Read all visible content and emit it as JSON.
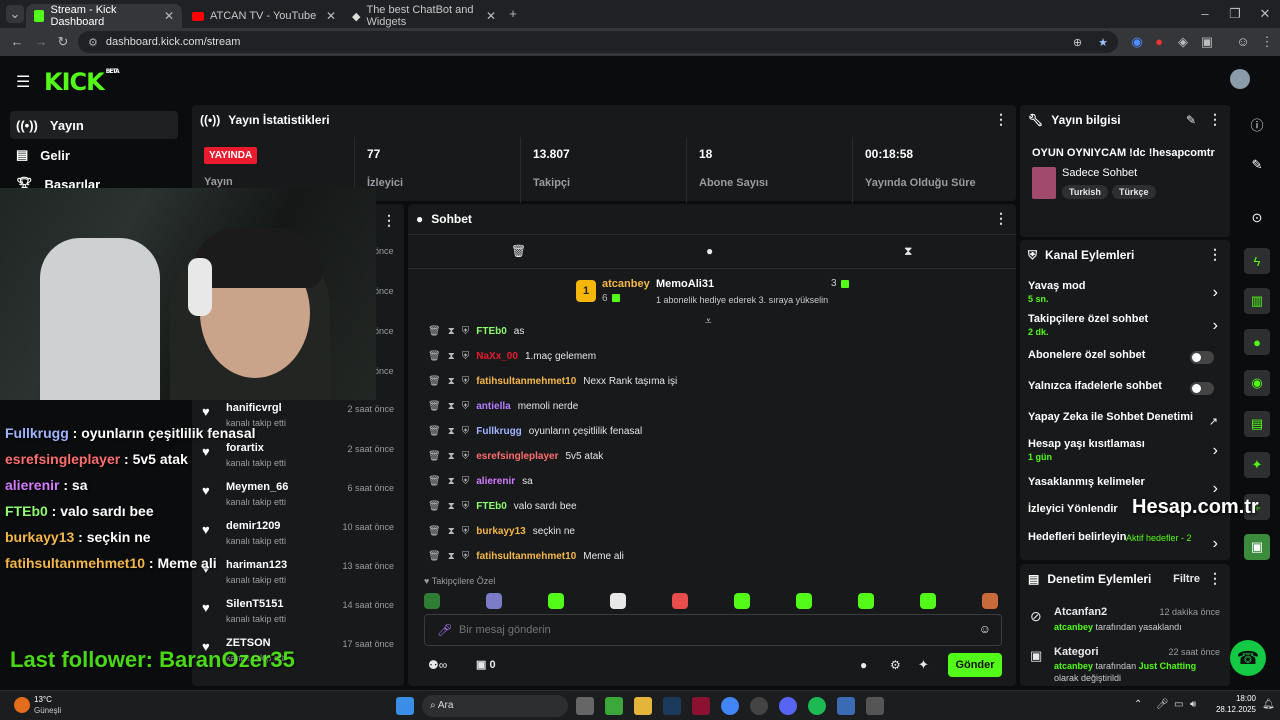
{
  "browser": {
    "tabs": [
      {
        "title": "Stream - Kick Dashboard",
        "active": true
      },
      {
        "title": "ATCAN TV - YouTube",
        "active": false
      },
      {
        "title": "The best ChatBot and Widgets",
        "active": false
      }
    ],
    "url": "dashboard.kick.com/stream"
  },
  "kick": {
    "logo": "KICK",
    "logo_sup": "BETA"
  },
  "sidebar": {
    "items": [
      {
        "label": "Yayın",
        "icon": "broadcast-icon"
      },
      {
        "label": "Gelir",
        "icon": "revenue-icon"
      },
      {
        "label": "Başarılar",
        "icon": "trophy-icon"
      }
    ]
  },
  "stats": {
    "title": "Yayın İstatistikleri",
    "live_badge": "YAYINDA",
    "live_label": "Yayın",
    "items": [
      {
        "value": "77",
        "label": "İzleyici"
      },
      {
        "value": "13.807",
        "label": "Takipçi"
      },
      {
        "value": "18",
        "label": "Abone Sayısı"
      },
      {
        "value": "00:18:58",
        "label": "Yayında Olduğu Süre"
      }
    ]
  },
  "followers": {
    "rows": [
      {
        "name": "hanificvrgl",
        "sub": "kanalı takip etti",
        "time": "2 saat önce"
      },
      {
        "name": "forartix",
        "sub": "kanalı takip etti",
        "time": "2 saat önce"
      },
      {
        "name": "Meymen_66",
        "sub": "kanalı takip etti",
        "time": "6 saat önce"
      },
      {
        "name": "demir1209",
        "sub": "kanalı takip etti",
        "time": "10 saat önce"
      },
      {
        "name": "hariman123",
        "sub": "kanalı takip etti",
        "time": "13 saat önce"
      },
      {
        "name": "SilenT5151",
        "sub": "kanalı takip etti",
        "time": "14 saat önce"
      },
      {
        "name": "ZETSON",
        "sub": "kanalı takip etti",
        "time": "17 saat önce"
      }
    ],
    "hidden_times": [
      "önce",
      "önce",
      "önce",
      "önce"
    ]
  },
  "chat": {
    "title": "Sohbet",
    "pinned": {
      "user1": "atcanbey",
      "rank": "1",
      "count1": "6",
      "user2": "MemoAli31",
      "count2": "3",
      "note": "1 abonelik hediye ederek 3. sıraya yükselin"
    },
    "messages": [
      {
        "user": "FTEb0",
        "text": "as",
        "color": "#8dfc6e"
      },
      {
        "user": "NaXx_00",
        "text": "1.maç gelemem",
        "color": "#ea1b2d"
      },
      {
        "user": "fatihsultanmehmet10",
        "text": "Nexx Rank taşıma işi",
        "color": "#f5b74a"
      },
      {
        "user": "antiella",
        "text": "memoli nerde",
        "color": "#b57cff"
      },
      {
        "user": "Fullkrugg",
        "text": "oyunların çeşitlilik fenasal",
        "color": "#9fb4ff"
      },
      {
        "user": "esrefsingleplayer",
        "text": "5v5 atak",
        "color": "#ff6e6e"
      },
      {
        "user": "alierenir",
        "text": "sa",
        "color": "#d37cff"
      },
      {
        "user": "FTEb0",
        "text": "valo sardı bee",
        "color": "#8dfc6e"
      },
      {
        "user": "burkayy13",
        "text": "seçkin ne",
        "color": "#f5b74a"
      },
      {
        "user": "fatihsultanmehmet10",
        "text": "Meme ali",
        "color": "#f5b74a"
      }
    ],
    "followers_only_label": "Takipçilere Özel",
    "input_placeholder": "Bir mesaj gönderin",
    "points": "0",
    "send_label": "Gönder"
  },
  "stream_info": {
    "title": "Yayın bilgisi",
    "stream_title": "OYUN OYNIYCAM !dc !hesapcomtr",
    "category": "Sadece Sohbet",
    "tags": [
      "Turkish",
      "Türkçe"
    ]
  },
  "channel_actions": {
    "title": "Kanal Eylemleri",
    "rows": [
      {
        "label": "Yavaş mod",
        "sub": "5 sn.",
        "kind": "chevron"
      },
      {
        "label": "Takipçilere özel sohbet",
        "sub": "2 dk.",
        "kind": "chevron"
      },
      {
        "label": "Abonelere özel sohbet",
        "sub": "",
        "kind": "toggle"
      },
      {
        "label": "Yalnızca ifadelerle sohbet",
        "sub": "",
        "kind": "toggle"
      },
      {
        "label": "Yapay Zeka ile Sohbet Denetimi",
        "sub": "",
        "kind": "external"
      },
      {
        "label": "Hesap yaşı kısıtlaması",
        "sub": "1 gün",
        "kind": "chevron"
      },
      {
        "label": "Yasaklanmış kelimeler",
        "sub": "",
        "kind": "chevron"
      },
      {
        "label": "İzleyici Yönlendir",
        "sub": "",
        "kind": "none"
      },
      {
        "label": "Hedefleri belirleyin",
        "sub": "",
        "kind": "chevron"
      }
    ],
    "goals_badge": "Aktif hedefler - 2"
  },
  "mod_actions": {
    "title": "Denetim Eylemleri",
    "filter": "Filtre",
    "rows": [
      {
        "title": "Atcanfan2",
        "time": "12 dakika önce",
        "actor": "atcanbey",
        "desc": "tarafından yasaklandı",
        "extra": ""
      },
      {
        "title": "Kategori",
        "time": "22 saat önce",
        "actor": "atcanbey",
        "desc": "tarafından",
        "extra": "Just Chatting",
        "tail": "olarak değiştirildi"
      }
    ]
  },
  "overlay": {
    "chat_lines": [
      {
        "user": "Fullkrugg",
        "text": " : oyunların çeşitlilik fenasal",
        "color": "#9fb4ff"
      },
      {
        "user": "esrefsingleplayer",
        "text": " : 5v5 atak",
        "color": "#ff6e6e"
      },
      {
        "user": "alierenir",
        "text": " : sa",
        "color": "#d37cff"
      },
      {
        "user": "FTEb0",
        "text": " : valo sardı bee",
        "color": "#8dfc6e"
      },
      {
        "user": "burkayy13",
        "text": " : seçkin ne",
        "color": "#f5b74a"
      },
      {
        "user": "fatihsultanmehmet10",
        "text": " : Meme ali",
        "color": "#f5b74a"
      }
    ],
    "last_follower": "Last follower: BaranOzer35",
    "watermark": "Hesap.com.tr"
  },
  "taskbar": {
    "weather_temp": "13°C",
    "weather_desc": "Güneşli",
    "search": "Ara",
    "time": "18:00",
    "date": "28.12.2025"
  },
  "colors": {
    "accent": "#53fc18",
    "live": "#ea1b2d",
    "panel": "#18191b"
  }
}
